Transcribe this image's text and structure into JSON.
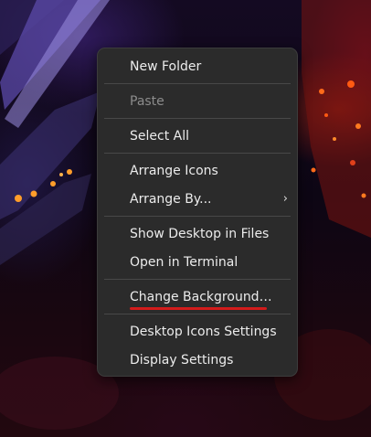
{
  "context_menu": {
    "items": [
      {
        "label": "New Folder"
      },
      {
        "label": "Paste",
        "disabled": true
      },
      {
        "label": "Select All"
      },
      {
        "label": "Arrange Icons"
      },
      {
        "label": "Arrange By..."
      },
      {
        "label": "Show Desktop in Files"
      },
      {
        "label": "Open in Terminal"
      },
      {
        "label": "Change Background…"
      },
      {
        "label": "Desktop Icons Settings"
      },
      {
        "label": "Display Settings"
      }
    ],
    "submenu_icon": "chevron-right-icon",
    "submenu_glyph": "›"
  },
  "colors": {
    "menu_background": "#2b2b2b",
    "menu_text": "#ececec",
    "disabled_text": "#8c8c8c",
    "separator": "#484848",
    "annotation_underline": "#d31b1b"
  }
}
